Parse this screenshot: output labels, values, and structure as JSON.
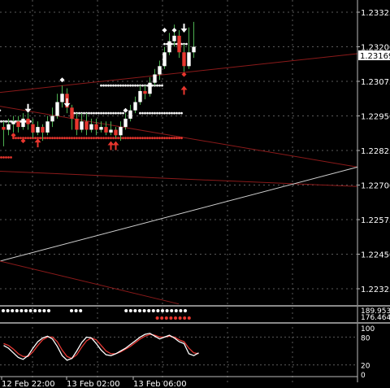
{
  "colors": {
    "background": "#000000",
    "grid": "#5a5a5a",
    "bull_candle": "#ffffff",
    "bear_candle": "#e8362e",
    "wick": "#4caf50",
    "trendline": "#8b1a1a",
    "diagonal_line": "#cfcfcf",
    "text": "#ffffff",
    "price_label_bg": "#ffffff",
    "oscillator_main": "#ffffff",
    "oscillator_signal": "#e53935"
  },
  "chart_data": {
    "type": "candlestick",
    "symbol": "",
    "y_ticks": [
      "1.23325",
      "1.23200",
      "1.23075",
      "1.22950",
      "1.22825",
      "1.22700",
      "1.22575",
      "1.22450",
      "1.22325"
    ],
    "ylim": [
      1.2227,
      1.2338
    ],
    "current_price": "1.23169",
    "current_price_value": 1.23169,
    "x_ticks": [
      "12 Feb 22:00",
      "13 Feb 02:00",
      "13 Feb 06:00"
    ],
    "grid": true,
    "candles": [
      [
        1.2291,
        1.229,
        1.2293,
        1.2284
      ],
      [
        1.229,
        1.2292,
        1.2294,
        1.2288
      ],
      [
        1.2292,
        1.2293,
        1.2295,
        1.2289
      ],
      [
        1.2293,
        1.2291,
        1.2295,
        1.2289
      ],
      [
        1.2291,
        1.2294,
        1.2296,
        1.229
      ],
      [
        1.2294,
        1.2292,
        1.2296,
        1.229
      ],
      [
        1.2292,
        1.2289,
        1.2294,
        1.2287
      ],
      [
        1.2289,
        1.2291,
        1.2293,
        1.2288
      ],
      [
        1.2291,
        1.2289,
        1.2292,
        1.2286
      ],
      [
        1.2289,
        1.2293,
        1.2295,
        1.2288
      ],
      [
        1.2293,
        1.2295,
        1.2298,
        1.2291
      ],
      [
        1.2295,
        1.23,
        1.2303,
        1.2294
      ],
      [
        1.23,
        1.2303,
        1.2306,
        1.2298
      ],
      [
        1.2303,
        1.2298,
        1.2305,
        1.2296
      ],
      [
        1.2298,
        1.2294,
        1.2299,
        1.229
      ],
      [
        1.2294,
        1.229,
        1.2296,
        1.2288
      ],
      [
        1.229,
        1.2293,
        1.2296,
        1.2289
      ],
      [
        1.2293,
        1.229,
        1.2296,
        1.2288
      ],
      [
        1.229,
        1.2292,
        1.2294,
        1.2289
      ],
      [
        1.2292,
        1.229,
        1.2294,
        1.2288
      ],
      [
        1.229,
        1.2291,
        1.2293,
        1.2289
      ],
      [
        1.2291,
        1.2289,
        1.2293,
        1.2288
      ],
      [
        1.2289,
        1.229,
        1.2293,
        1.2288
      ],
      [
        1.229,
        1.2288,
        1.2291,
        1.2287
      ],
      [
        1.2288,
        1.2291,
        1.2293,
        1.2286
      ],
      [
        1.2291,
        1.2294,
        1.2296,
        1.229
      ],
      [
        1.2294,
        1.2297,
        1.2299,
        1.2293
      ],
      [
        1.2297,
        1.23,
        1.2302,
        1.2296
      ],
      [
        1.23,
        1.2304,
        1.2306,
        1.2299
      ],
      [
        1.2304,
        1.2303,
        1.2306,
        1.2301
      ],
      [
        1.2303,
        1.2307,
        1.2309,
        1.2302
      ],
      [
        1.2307,
        1.231,
        1.2312,
        1.2306
      ],
      [
        1.231,
        1.2313,
        1.2315,
        1.2308
      ],
      [
        1.2313,
        1.2318,
        1.232,
        1.2312
      ],
      [
        1.2318,
        1.2322,
        1.2325,
        1.2317
      ],
      [
        1.2322,
        1.2324,
        1.2328,
        1.232
      ],
      [
        1.2324,
        1.2318,
        1.2326,
        1.2316
      ],
      [
        1.2318,
        1.2313,
        1.2321,
        1.2311
      ],
      [
        1.2313,
        1.2318,
        1.2327,
        1.2312
      ],
      [
        1.2318,
        1.232,
        1.2329,
        1.2316
      ]
    ],
    "resistance_dots": [
      {
        "y": 1.2306,
        "from": 20,
        "to": 32
      },
      {
        "y": 1.2296,
        "from": 14,
        "to": 24
      },
      {
        "y": 1.2296,
        "from": 28,
        "to": 36
      },
      {
        "y": 1.2293,
        "from": -1,
        "to": 5
      },
      {
        "y": 1.2321,
        "from": 33,
        "to": 37
      }
    ],
    "support_dots": [
      {
        "y": 1.2287,
        "from": 2,
        "to": 16
      },
      {
        "y": 1.2287,
        "from": 17,
        "to": 36
      },
      {
        "y": 1.228,
        "from": -1,
        "to": 1
      }
    ],
    "white_arrows_down": [
      {
        "i": 5,
        "y": 1.2297
      },
      {
        "i": 13,
        "y": 1.2299
      },
      {
        "i": 37,
        "y": 1.2326
      }
    ],
    "white_diamonds": [
      {
        "i": 12,
        "y": 1.2308
      },
      {
        "i": 25,
        "y": 1.2297
      },
      {
        "i": 33,
        "y": 1.2326
      },
      {
        "i": 35,
        "y": 1.2326
      },
      {
        "i": -1,
        "y": 1.2297
      }
    ],
    "red_arrows_up": [
      {
        "i": 7,
        "y": 1.2286
      },
      {
        "i": 22,
        "y": 1.2285
      },
      {
        "i": 23,
        "y": 1.2285
      },
      {
        "i": 37,
        "y": 1.2305
      }
    ],
    "red_diamonds": [
      {
        "i": 2,
        "y": 1.2288
      },
      {
        "i": 4,
        "y": 1.2286
      },
      {
        "i": 37,
        "y": 1.231
      }
    ],
    "trendlines": [
      {
        "x1": 0,
        "y1": 1.23035,
        "x2": 440,
        "y2": 1.23175,
        "color": "trendline"
      },
      {
        "x1": 0,
        "y1": 1.22985,
        "x2": 440,
        "y2": 1.22765,
        "color": "trendline"
      },
      {
        "x1": 0,
        "y1": 1.2275,
        "x2": 440,
        "y2": 1.22695,
        "color": "trendline"
      },
      {
        "x1": 0,
        "y1": 1.22425,
        "x2": 440,
        "y2": 1.22765,
        "color": "diagonal_line"
      },
      {
        "x1": 0,
        "y1": 1.22425,
        "x2": 220,
        "y2": 1.2227,
        "color": "trendline"
      }
    ],
    "dot_indicator": {
      "white_rows": [
        [
          0,
          10
        ],
        [
          15,
          17
        ],
        [
          27,
          40
        ]
      ],
      "red_rows": [
        [
          16,
          20
        ],
        [
          21,
          23
        ]
      ]
    },
    "mid_indicator_labels": [
      "189.9539",
      "176.4644"
    ],
    "oscillator": {
      "ticks": [
        "100",
        "80",
        "20",
        "0"
      ],
      "main": [
        62,
        56,
        46,
        36,
        32,
        40,
        56,
        70,
        78,
        82,
        76,
        60,
        40,
        30,
        34,
        50,
        68,
        80,
        78,
        66,
        52,
        42,
        40,
        44,
        50,
        56,
        64,
        72,
        80,
        86,
        88,
        82,
        76,
        80,
        84,
        78,
        70,
        66,
        44,
        40,
        46
      ],
      "signal": [
        66,
        62,
        54,
        44,
        38,
        38,
        48,
        62,
        74,
        80,
        80,
        70,
        52,
        38,
        34,
        42,
        58,
        72,
        78,
        74,
        62,
        50,
        44,
        44,
        48,
        54,
        60,
        68,
        76,
        82,
        86,
        84,
        80,
        80,
        82,
        80,
        74,
        70,
        56,
        46,
        44
      ]
    }
  }
}
